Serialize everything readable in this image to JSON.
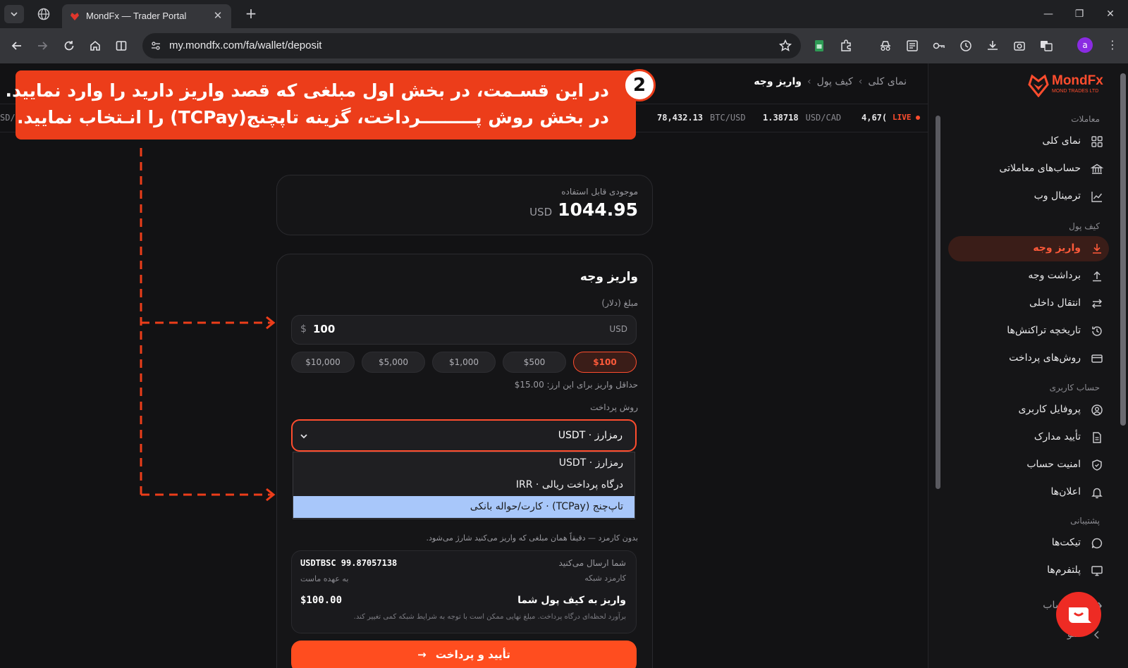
{
  "browser": {
    "tab_title": "MondFx — Trader Portal",
    "url": "my.mondfx.com/fa/wallet/deposit",
    "profile_initial": "a"
  },
  "breadcrumb": {
    "items": [
      "نمای کلی",
      "کیف پول"
    ],
    "current": "واریز وجه",
    "separator": "›"
  },
  "ticker": [
    {
      "value": "78,432.13",
      "symbol": "BTC/USD"
    },
    {
      "value": "1.38718",
      "symbol": "USD/CAD"
    },
    {
      "value": "4,67(",
      "symbol": ""
    }
  ],
  "ticker_clipped": "SD/C",
  "live_label": "LIVE",
  "balance": {
    "label": "موجودی قابل استفاده",
    "amount": "1044.95",
    "currency": "USD"
  },
  "deposit": {
    "title": "واریز وجه",
    "amount_label": "مبلغ (دلار)",
    "currency_symbol": "$",
    "amount_value": "100",
    "amount_currency": "USD",
    "presets": [
      "$10,000",
      "$5,000",
      "$1,000",
      "$500",
      "$100"
    ],
    "active_preset": "$100",
    "min_note": "حداقل واریز برای این ارز: 15.00$",
    "payment_method_label": "روش پرداخت",
    "selected_method": "رمزارز · USDT",
    "options": [
      "رمزارز · USDT",
      "درگاه پرداخت ریالی · IRR",
      "تاپ‌چنج (TCPay) · کارت/حواله بانکی"
    ],
    "highlighted_option": 2,
    "fee_note": "بدون کارمزد — دقیقاً همان مبلغی که واریز می‌کنید شارژ می‌شود.",
    "summary": {
      "you_send_label": "شما ارسال می‌کنید",
      "you_send_value": "USDTBSC 99.87057138",
      "network_fee_label": "کارمزد شبکه",
      "network_fee_value": "به عهده ماست",
      "wallet_label": "واریز به کیف پول شما",
      "wallet_value": "$100.00",
      "note": "برآورد لحظه‌ای درگاه پرداخت. مبلغ نهایی ممکن است با توجه به شرایط شبکه کمی تغییر کند."
    },
    "submit_label": "تأیید و پرداخت"
  },
  "annotation": {
    "number": "2",
    "line1": "در این قسـمت، در بخش اول مبلغی که قصد واریز دارید را وارد نمایید.",
    "line2": "در بخش روش پـــــــــرداخت، گزینه تاپچنج(TCPay) را انـتخاب نمایید."
  },
  "sidebar": {
    "logo": "MondFx",
    "logo_sub": "MOND TRADES LTD",
    "sections": {
      "trading": "معاملات",
      "wallet": "کیف پول",
      "account": "حساب کاربری",
      "support": "پشتیبانی"
    },
    "items": [
      {
        "label": "نمای کلی",
        "icon": "grid-icon"
      },
      {
        "label": "حساب‌های معاملاتی",
        "icon": "bank-icon"
      },
      {
        "label": "ترمینال وب",
        "icon": "chart-line-icon"
      },
      {
        "label": "واریز وجه",
        "icon": "download-icon"
      },
      {
        "label": "برداشت وجه",
        "icon": "upload-icon"
      },
      {
        "label": "انتقال داخلی",
        "icon": "transfer-icon"
      },
      {
        "label": "تاریخچه تراکنش‌ها",
        "icon": "history-icon"
      },
      {
        "label": "روش‌های پرداخت",
        "icon": "card-icon"
      },
      {
        "label": "پروفایل کاربری",
        "icon": "user-icon"
      },
      {
        "label": "تأیید مدارک",
        "icon": "document-icon"
      },
      {
        "label": "امنیت حساب",
        "icon": "shield-icon"
      },
      {
        "label": "اعلان‌ها",
        "icon": "bell-icon"
      },
      {
        "label": "تیکت‌ها",
        "icon": "chat-bubble-icon"
      },
      {
        "label": "پلتفرم‌ها",
        "icon": "monitor-icon"
      },
      {
        "label": "از حساب",
        "icon": "logout-icon"
      },
      {
        "label": "منو",
        "icon": "collapse-icon"
      }
    ],
    "active_index": 3
  },
  "colors": {
    "accent": "#ff4d2e",
    "annotation": "#ec3d1a",
    "highlight": "#a8c7fa"
  }
}
